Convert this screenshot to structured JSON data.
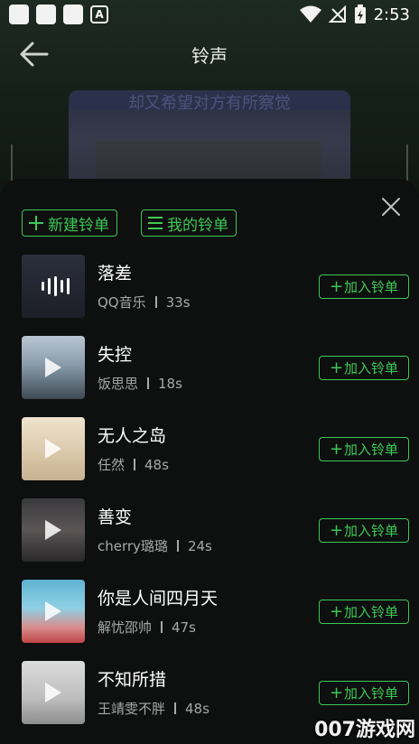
{
  "status_bar": {
    "time": "2:53"
  },
  "header": {
    "title": "铃声"
  },
  "background": {
    "caption": "却又希望对方有所察觉"
  },
  "tabs": {
    "new_playlist": "新建铃单",
    "my_playlist": "我的铃单"
  },
  "songs": [
    {
      "name": "落差",
      "artist": "QQ音乐",
      "duration": "33s",
      "thumb": "waveform"
    },
    {
      "name": "失控",
      "artist": "饭思思",
      "duration": "18s",
      "thumb": "play"
    },
    {
      "name": "无人之岛",
      "artist": "任然",
      "duration": "48s",
      "thumb": "play"
    },
    {
      "name": "善变",
      "artist": "cherry璐璐",
      "duration": "24s",
      "thumb": "play"
    },
    {
      "name": "你是人间四月天",
      "artist": "解忧邵帅",
      "duration": "47s",
      "thumb": "play"
    },
    {
      "name": "不知所措",
      "artist": "王靖雯不胖",
      "duration": "48s",
      "thumb": "play"
    }
  ],
  "add_label": "加入铃单",
  "watermark": "007游戏网",
  "colors": {
    "accent": "#3dc956",
    "sheet": "#0e0f0f"
  }
}
